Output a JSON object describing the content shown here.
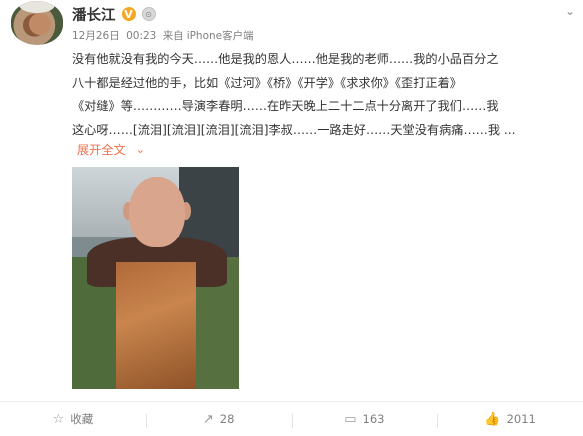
{
  "post": {
    "author": "潘长江",
    "verified_badge": "V",
    "member_badge": "⊙",
    "more_icon": "chevron-down-icon",
    "date": "12月26日",
    "time": "00:23",
    "source_prefix": "来自",
    "source": "iPhone客户端",
    "content_lines": [
      "没有他就没有我的今天……他是我的恩人……他是我的老师……我的小品百分之",
      "八十都是经过他的手，比如《过河》《桥》《开学》《求求你》《歪打正着》",
      "《对缝》等…………导演李春明……在昨天晚上二十二点十分离开了我们……我",
      "这心呀……[流泪][流泪][流泪][流泪]李叔……一路走好……天堂没有病痛……我 ..."
    ],
    "expand_label": "展开全文",
    "expand_icon": "chevron-down-icon"
  },
  "actions": {
    "favorite_label": "收藏",
    "repost_count": "28",
    "comment_count": "163",
    "like_count": "2011"
  },
  "colors": {
    "accent": "#eb7350",
    "verified": "#f5a623"
  }
}
